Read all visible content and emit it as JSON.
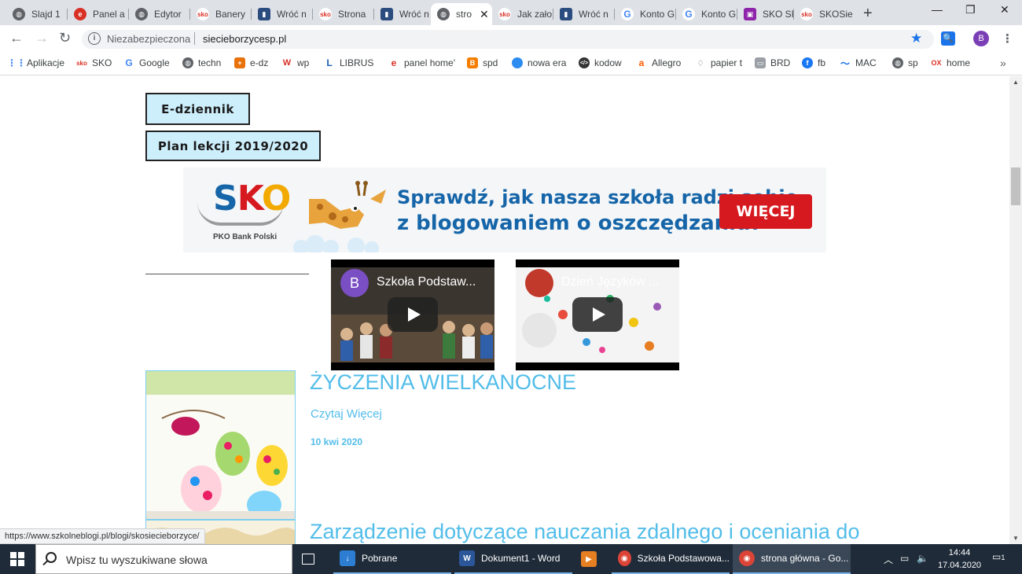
{
  "browser": {
    "tabs": [
      {
        "label": "Slajd 1",
        "icon": "globe-icon",
        "color": "#5f6368"
      },
      {
        "label": "Panel a",
        "icon": "e-icon",
        "color": "#d93025"
      },
      {
        "label": "Edytor",
        "icon": "globe-icon",
        "color": "#5f6368"
      },
      {
        "label": "Banery",
        "icon": "sko-icon",
        "color": "#d93025"
      },
      {
        "label": "Wróć n",
        "icon": "jar-icon",
        "color": "#2b4c7e"
      },
      {
        "label": "Strona",
        "icon": "sko-icon",
        "color": "#d93025"
      },
      {
        "label": "Wróć n",
        "icon": "jar-icon",
        "color": "#2b4c7e"
      },
      {
        "label": "stro",
        "icon": "globe-icon",
        "color": "#5f6368"
      },
      {
        "label": "Jak zało",
        "icon": "sko-icon",
        "color": "#d93025"
      },
      {
        "label": "Wróć n",
        "icon": "jar-icon",
        "color": "#2b4c7e"
      },
      {
        "label": "Konto G",
        "icon": "google-icon",
        "color": "#4285f4"
      },
      {
        "label": "Konto G",
        "icon": "google-icon",
        "color": "#4285f4"
      },
      {
        "label": "SKO SP",
        "icon": "classroom-icon",
        "color": "#8e24aa"
      },
      {
        "label": "SKOSie",
        "icon": "sko-icon",
        "color": "#d93025"
      }
    ],
    "active_tab_index": 7,
    "window_controls": {
      "minimize": "—",
      "restore": "❐",
      "close": "✕"
    },
    "address": {
      "security_label": "Niezabezpieczona",
      "url": "siecieborzycesp.pl"
    },
    "profile_initial": "B",
    "bookmarks": [
      {
        "label": "Aplikacje",
        "icon": "apps-grid-icon",
        "color": "#4285f4"
      },
      {
        "label": "SKO",
        "icon": "sko-icon",
        "color": "#d93025"
      },
      {
        "label": "Google",
        "icon": "google-icon",
        "color": "#4285f4"
      },
      {
        "label": "techn",
        "icon": "globe-icon",
        "color": "#5f6368"
      },
      {
        "label": "e-dz",
        "icon": "plus-icon",
        "color": "#e8710a"
      },
      {
        "label": "wp",
        "icon": "wp-icon",
        "color": "#d93025"
      },
      {
        "label": "LIBRUS",
        "icon": "librus-icon",
        "color": "#1a5fb4"
      },
      {
        "label": "panel home'",
        "icon": "e-icon",
        "color": "#d93025"
      },
      {
        "label": "spd",
        "icon": "blogger-icon",
        "color": "#f57d00"
      },
      {
        "label": "nowa era",
        "icon": "circle-icon",
        "color": "#2d8cf0"
      },
      {
        "label": "kodow",
        "icon": "code-icon",
        "color": "#333333"
      },
      {
        "label": "Allegro",
        "icon": "allegro-icon",
        "color": "#ff5a00"
      },
      {
        "label": "papier t",
        "icon": "bulb-icon",
        "color": "#5f6368"
      },
      {
        "label": "BRD",
        "icon": "printer-icon",
        "color": "#5f6368"
      },
      {
        "label": "fb",
        "icon": "facebook-icon",
        "color": "#1877f2"
      },
      {
        "label": "MAC",
        "icon": "wave-icon",
        "color": "#1a73e8"
      },
      {
        "label": "sp",
        "icon": "globe-icon",
        "color": "#5f6368"
      },
      {
        "label": "home",
        "icon": "ox-icon",
        "color": "#d93025"
      }
    ],
    "status_url": "https://www.szkolneblogi.pl/blogi/skosiecieborzyce/"
  },
  "page": {
    "buttons": [
      {
        "label": "E-dziennik"
      },
      {
        "label": "Plan lekcji 2019/2020"
      }
    ],
    "banner": {
      "logo_text": "SKO",
      "logo_sub": "PKO Bank Polski",
      "line1": "Sprawdź, jak nasza szkoła radzi sobie",
      "line2": "z blogowaniem o oszczędzaniu!",
      "cta": "WIĘCEJ",
      "colors": {
        "primary": "#1565a8",
        "cta": "#d6191f"
      }
    },
    "videos": [
      {
        "title": "Szkoła Podstaw...",
        "channel_initial": "B",
        "avatar_color": "#7b4fc4"
      },
      {
        "title": "Dzień Języków ...",
        "channel_initial": "",
        "avatar_color": "#c0392b"
      }
    ],
    "posts": [
      {
        "title": "ŻYCZENIA WIELKANOCNE",
        "read_more": "Czytaj Więcej",
        "date": "10 kwi 2020"
      },
      {
        "title": "Zarządzenie dotyczące nauczania zdalnego i oceniania do"
      }
    ],
    "link_color": "#52bde9"
  },
  "taskbar": {
    "search_placeholder": "Wpisz tu wyszukiwane słowa",
    "items": [
      {
        "label": "",
        "icon": "task-view-icon"
      },
      {
        "label": "Pobrane",
        "icon": "download-folder-icon",
        "color": "#2d7dd2"
      },
      {
        "label": "Dokument1 - Word",
        "icon": "word-icon",
        "color": "#2b579a"
      },
      {
        "label": "",
        "icon": "media-player-icon",
        "color": "#e67e22"
      },
      {
        "label": "Szkoła Podstawowa...",
        "icon": "chrome-icon",
        "color": "#db4437"
      },
      {
        "label": "strona główna - Go...",
        "icon": "chrome-icon",
        "color": "#db4437"
      }
    ],
    "time": "14:44",
    "date": "17.04.2020",
    "notification_count": "1"
  }
}
